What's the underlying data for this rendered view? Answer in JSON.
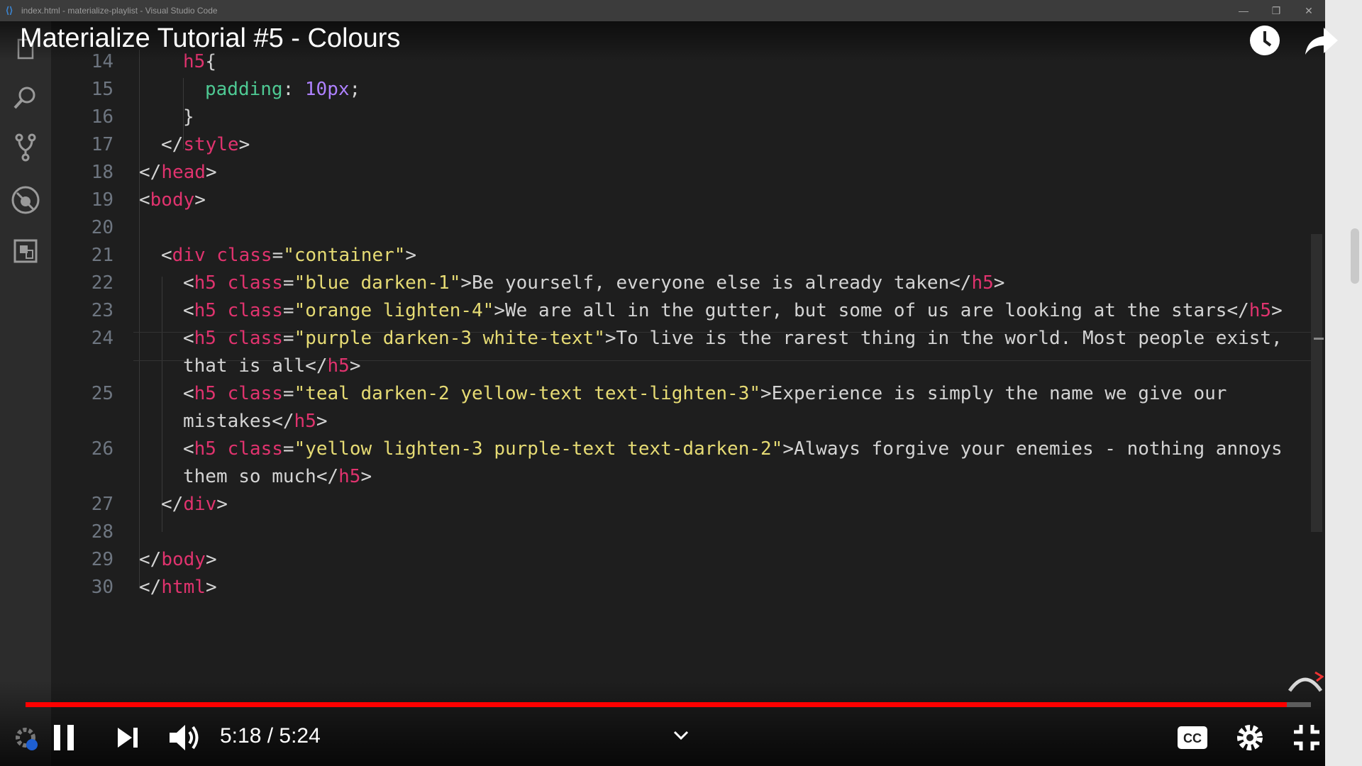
{
  "window": {
    "title": "index.html - materialize-playlist - Visual Studio Code",
    "controls": [
      "—",
      "❐",
      "✕"
    ]
  },
  "video": {
    "title": "Materialize Tutorial #5 - Colours",
    "time_current": "5:18",
    "time_total": "5:24",
    "time_display": "5:18 / 5:24",
    "progress": 0.981,
    "accent_color": "#ff0000"
  },
  "activity_bar": {
    "icons": [
      "files-icon",
      "search-icon",
      "source-control-icon",
      "debug-icon",
      "extensions-icon"
    ]
  },
  "editor": {
    "cursor_line": 23,
    "lines": [
      {
        "n": "14",
        "tokens": [
          [
            "t",
            "h5"
          ],
          [
            "p",
            "{"
          ]
        ]
      },
      {
        "n": "15",
        "tokens": [
          [
            "prop",
            "padding"
          ],
          [
            "p",
            ": "
          ],
          [
            "num",
            "10px"
          ],
          [
            "p",
            ";"
          ]
        ]
      },
      {
        "n": "16",
        "tokens": [
          [
            "p",
            "}"
          ]
        ]
      },
      {
        "n": "17",
        "tokens": [
          [
            "p",
            "</"
          ],
          [
            "t",
            "style"
          ],
          [
            "p",
            ">"
          ]
        ]
      },
      {
        "n": "18",
        "tokens": [
          [
            "p",
            "</"
          ],
          [
            "t",
            "head"
          ],
          [
            "p",
            ">"
          ]
        ]
      },
      {
        "n": "19",
        "tokens": [
          [
            "p",
            "<"
          ],
          [
            "t",
            "body"
          ],
          [
            "p",
            ">"
          ]
        ]
      },
      {
        "n": "20",
        "tokens": []
      },
      {
        "n": "21",
        "tokens": [
          [
            "p",
            "<"
          ],
          [
            "t",
            "div"
          ],
          [
            "p",
            " "
          ],
          [
            "a",
            "class"
          ],
          [
            "p",
            "="
          ],
          [
            "s",
            "\"container\""
          ],
          [
            "p",
            ">"
          ]
        ]
      },
      {
        "n": "22",
        "tokens": [
          [
            "p",
            "<"
          ],
          [
            "t",
            "h5"
          ],
          [
            "p",
            " "
          ],
          [
            "a",
            "class"
          ],
          [
            "p",
            "="
          ],
          [
            "s",
            "\"blue darken-1\""
          ],
          [
            "p",
            ">Be yourself, everyone else is already taken</"
          ],
          [
            "t",
            "h5"
          ],
          [
            "p",
            ">"
          ]
        ]
      },
      {
        "n": "23",
        "tokens": [
          [
            "p",
            "<"
          ],
          [
            "t",
            "h5"
          ],
          [
            "p",
            " "
          ],
          [
            "a",
            "class"
          ],
          [
            "p",
            "="
          ],
          [
            "s",
            "\"orange lighten-4\""
          ],
          [
            "p",
            ">We are all in the gutter, but some of us are looking at the stars</"
          ],
          [
            "t",
            "h5"
          ],
          [
            "p",
            ">"
          ]
        ]
      },
      {
        "n": "24",
        "tokens": [
          [
            "p",
            "<"
          ],
          [
            "t",
            "h5"
          ],
          [
            "p",
            " "
          ],
          [
            "a",
            "class"
          ],
          [
            "p",
            "="
          ],
          [
            "s",
            "\"purple darken-3 white-text\""
          ],
          [
            "p",
            ">To live is the rarest thing in the world. Most people exist,"
          ]
        ]
      },
      {
        "n": "",
        "tokens": [
          [
            "p",
            "that is all</"
          ],
          [
            "t",
            "h5"
          ],
          [
            "p",
            ">"
          ]
        ]
      },
      {
        "n": "25",
        "tokens": [
          [
            "p",
            "<"
          ],
          [
            "t",
            "h5"
          ],
          [
            "p",
            " "
          ],
          [
            "a",
            "class"
          ],
          [
            "p",
            "="
          ],
          [
            "s",
            "\"teal darken-2 yellow-text text-lighten-3\""
          ],
          [
            "p",
            ">Experience is simply the name we give our"
          ]
        ]
      },
      {
        "n": "",
        "tokens": [
          [
            "p",
            "mistakes</"
          ],
          [
            "t",
            "h5"
          ],
          [
            "p",
            ">"
          ]
        ]
      },
      {
        "n": "26",
        "tokens": [
          [
            "p",
            "<"
          ],
          [
            "t",
            "h5"
          ],
          [
            "p",
            " "
          ],
          [
            "a",
            "class"
          ],
          [
            "p",
            "="
          ],
          [
            "s",
            "\"yellow lighten-3 purple-text text-darken-2\""
          ],
          [
            "p",
            ">Always forgive your enemies - nothing annoys"
          ]
        ]
      },
      {
        "n": "",
        "tokens": [
          [
            "p",
            "them so much</"
          ],
          [
            "t",
            "h5"
          ],
          [
            "p",
            ">"
          ]
        ]
      },
      {
        "n": "27",
        "tokens": [
          [
            "p",
            "</"
          ],
          [
            "t",
            "div"
          ],
          [
            "p",
            ">"
          ]
        ]
      },
      {
        "n": "28",
        "tokens": []
      },
      {
        "n": "29",
        "tokens": [
          [
            "p",
            "</"
          ],
          [
            "t",
            "body"
          ],
          [
            "p",
            ">"
          ]
        ]
      },
      {
        "n": "30",
        "tokens": [
          [
            "p",
            "</"
          ],
          [
            "t",
            "html"
          ],
          [
            "p",
            ">"
          ]
        ]
      }
    ]
  },
  "player_controls": {
    "left": [
      "pause-icon",
      "next-icon",
      "volume-icon"
    ],
    "right": [
      "captions-icon",
      "settings-icon",
      "exit-fullscreen-icon"
    ],
    "top_right": [
      "watch-later-icon",
      "share-icon"
    ],
    "captions_label": "CC"
  }
}
